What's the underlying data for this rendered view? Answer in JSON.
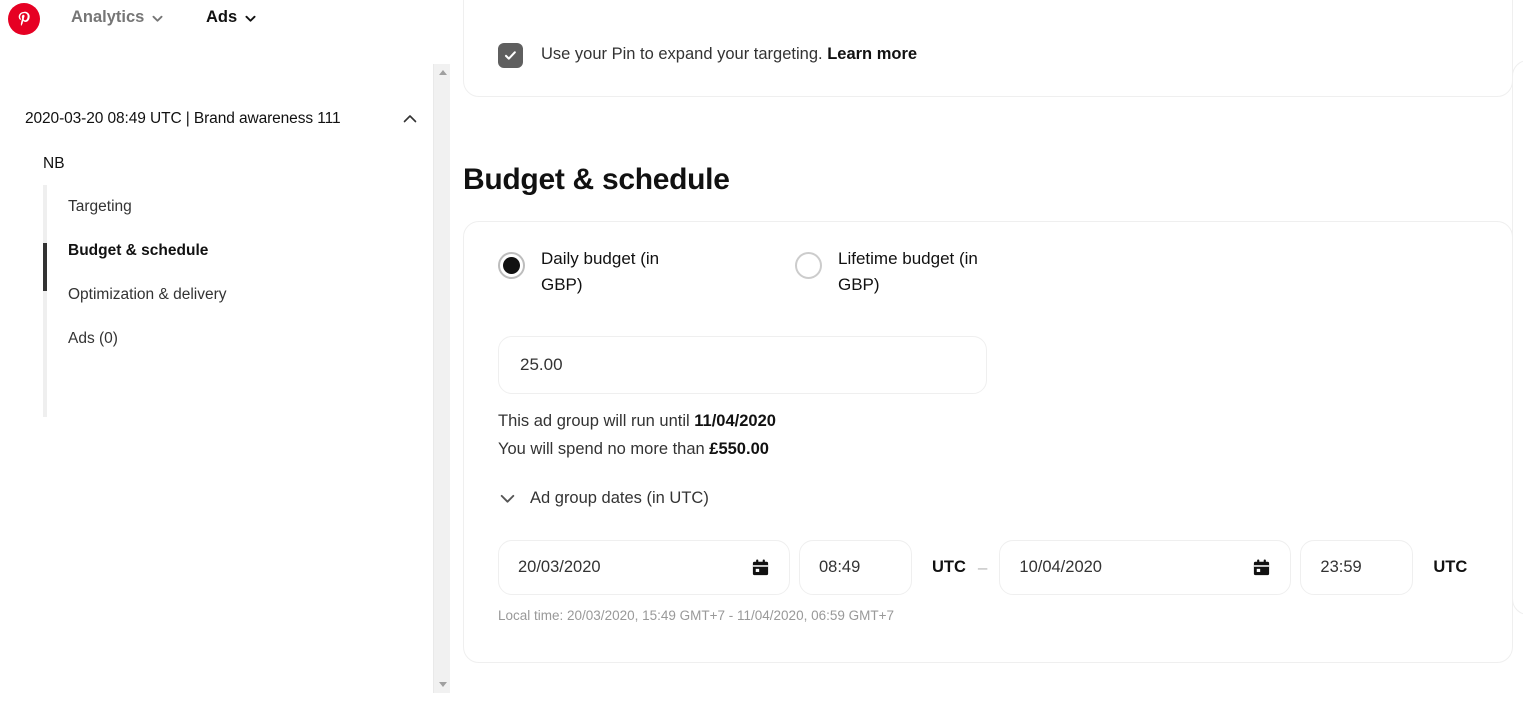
{
  "brand": {
    "logo_icon": "pinterest-logo-icon",
    "logo_color": "#e60023"
  },
  "topnav": {
    "items": [
      {
        "label": "Analytics",
        "icon": "chevron-down-icon"
      },
      {
        "label": "Ads",
        "icon": "chevron-down-icon"
      }
    ]
  },
  "sidebar": {
    "campaign_header": "2020-03-20 08:49 UTC | Brand awareness 111",
    "collapse_icon": "chevron-up-icon",
    "adgroup_name": "NB",
    "items": [
      {
        "label": "Targeting",
        "active": false
      },
      {
        "label": "Budget & schedule",
        "active": true
      },
      {
        "label": "Optimization & delivery",
        "active": false
      },
      {
        "label": "Ads (0)",
        "active": false
      }
    ],
    "scrollbar": {
      "up_icon": "scroll-up-arrow-icon",
      "down_icon": "scroll-down-arrow-icon"
    }
  },
  "targeting_card": {
    "checkbox_icon": "checkbox-checked-icon",
    "text_before": "Use your Pin to expand your targeting.",
    "learn_more": "Learn more"
  },
  "main": {
    "section_title": "Budget & schedule",
    "budget_type": {
      "options": [
        {
          "label": "Daily budget (in GBP)",
          "selected": true
        },
        {
          "label": "Lifetime budget (in GBP)",
          "selected": false
        }
      ]
    },
    "budget_amount": "25.00",
    "summary": {
      "run_until_prefix": "This ad group will run until ",
      "run_until_date": "11/04/2020",
      "spend_prefix": "You will spend no more than ",
      "spend_amount": "£550.00"
    },
    "dates": {
      "toggle_label": "Ad group dates (in UTC)",
      "toggle_icon": "chevron-down-icon",
      "start_date": "20/03/2020",
      "start_date_icon": "calendar-icon",
      "start_time": "08:49",
      "start_tz": "UTC",
      "separator": "–",
      "end_date": "10/04/2020",
      "end_date_icon": "calendar-icon",
      "end_time": "23:59",
      "end_tz": "UTC",
      "local_time_note": "Local time: 20/03/2020, 15:49 GMT+7 - 11/04/2020, 06:59 GMT+7"
    }
  }
}
